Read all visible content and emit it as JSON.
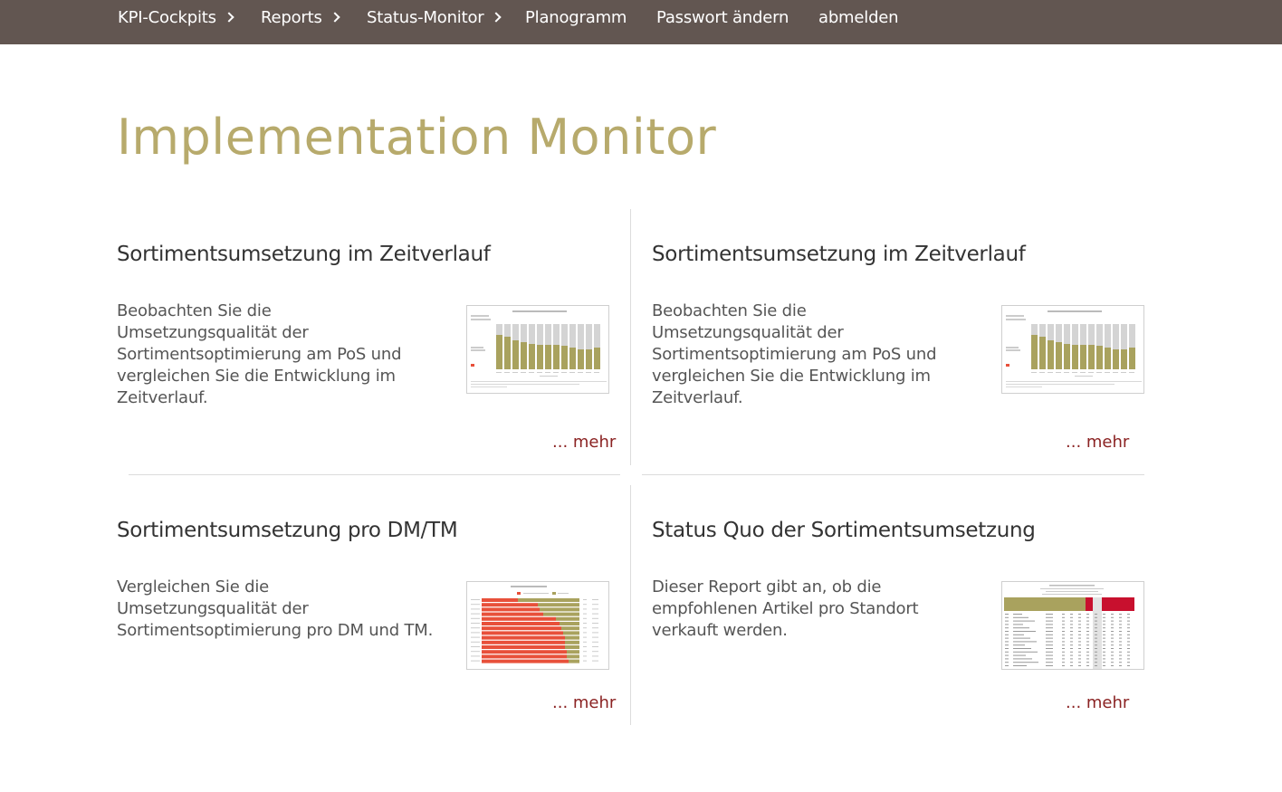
{
  "nav": {
    "items": [
      {
        "label": "KPI-Cockpits",
        "has_chevron": true
      },
      {
        "label": "Reports",
        "has_chevron": true
      },
      {
        "label": "Status-Monitor",
        "has_chevron": true
      },
      {
        "label": "Planogramm",
        "has_chevron": false
      },
      {
        "label": "Passwort ändern",
        "has_chevron": false
      },
      {
        "label": "abmelden",
        "has_chevron": false
      }
    ]
  },
  "page": {
    "title": "Implementation Monitor"
  },
  "cards": [
    {
      "title": "Sortimentsumsetzung im Zeitverlauf",
      "description": "Beobachten Sie die Umsetzungsqualität der Sortimentsoptimierung am PoS und vergleichen Sie die Entwicklung im Zeitverlauf.",
      "more": "... mehr",
      "thumbnail": "stacked-column-chart-thumbnail"
    },
    {
      "title": "Sortimentsumsetzung im Zeitverlauf",
      "description": "Beobachten Sie die Umsetzungsqualität der Sortimentsoptimierung am PoS und vergleichen Sie die Entwicklung im Zeitverlauf.",
      "more": "... mehr",
      "thumbnail": "stacked-column-chart-thumbnail"
    },
    {
      "title": "Sortimentsumsetzung pro DM/TM",
      "description": "Vergleichen Sie die Umsetzungsqualität der Sortimentsoptimierung pro DM und TM.",
      "more": "... mehr",
      "thumbnail": "horizontal-bar-chart-thumbnail"
    },
    {
      "title": "Status Quo der Sortimentsumsetzung",
      "description": "Dieser Report gibt an, ob die empfohlenen Artikel pro Standort verkauft werden.",
      "more": "... mehr",
      "thumbnail": "table-report-thumbnail"
    }
  ],
  "colors": {
    "nav_bg": "#625651",
    "title": "#b7aa6c",
    "link": "#8b2323",
    "chart_olive": "#a9a25e",
    "chart_grey": "#d4d4d4",
    "chart_red": "#e8503a",
    "table_red": "#c8102e"
  }
}
